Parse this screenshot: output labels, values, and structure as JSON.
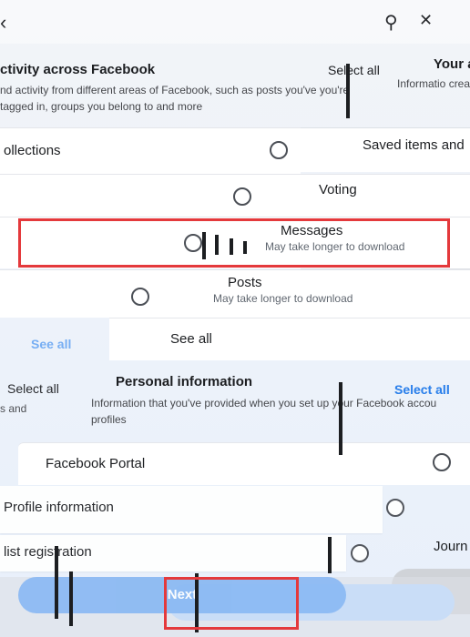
{
  "header": {
    "back_glyph": "‹",
    "search_glyph": "⚲",
    "close_glyph": "✕"
  },
  "activity_section": {
    "title": "ctivity across Facebook",
    "description": "nd activity from different areas of Facebook, such as posts you've you're tagged in, groups you belong to and more",
    "select_all": "Select all",
    "rows": [
      {
        "label": "ollections"
      },
      {
        "label": "Voting"
      },
      {
        "label": "Messages",
        "sublabel": "May take longer to download"
      },
      {
        "label": "Posts",
        "sublabel": "May take longer to download"
      }
    ],
    "see_all": "See all",
    "see_all_ghost": "See all"
  },
  "right_ghost": {
    "title": "Your a",
    "description": "Informatio created, photo",
    "saved_items_label": "Saved items and",
    "select_all": "Select all",
    "journal_label": "Journ"
  },
  "personal_section": {
    "select_all_left": "Select all",
    "left_fragment": "s and",
    "title": "Personal information",
    "description": "Information that you've provided when you set up your Facebook accou profiles",
    "select_all_right": "Select all",
    "rows": [
      {
        "label": "Facebook Portal"
      },
      {
        "label": "Profile information"
      },
      {
        "label": "list registration"
      }
    ]
  },
  "footer": {
    "next_label": "Next",
    "ghost_label": "Next"
  },
  "colors": {
    "accent_blue": "#1b74e4",
    "next_button_blue": "#7fb2f2",
    "highlight_red": "#e4393c"
  }
}
